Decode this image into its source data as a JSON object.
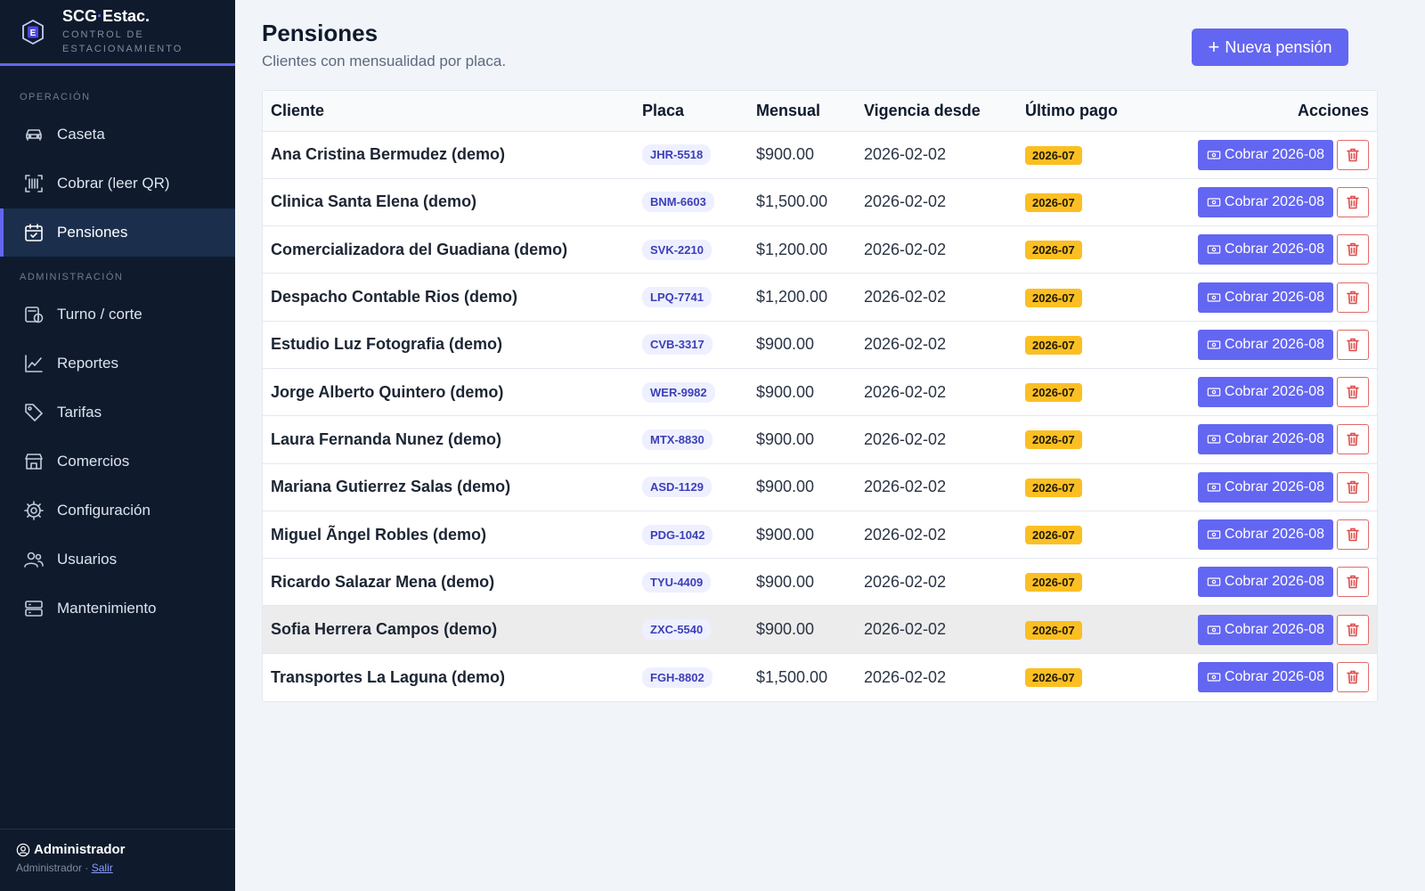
{
  "brand": {
    "name_main": "SCG",
    "name_suffix": "Estac.",
    "subtitle_line1": "CONTROL DE",
    "subtitle_line2": "ESTACIONAMIENTO",
    "logo_letter": "E"
  },
  "sidebar": {
    "section_operacion": "OPERACIÓN",
    "section_admin": "ADMINISTRACIÓN",
    "items": [
      {
        "label": "Caseta",
        "icon": "car-icon"
      },
      {
        "label": "Cobrar (leer QR)",
        "icon": "qr-scan-icon"
      },
      {
        "label": "Pensiones",
        "icon": "calendar-check-icon",
        "active": true
      },
      {
        "label": "Turno / corte",
        "icon": "cash-register-icon"
      },
      {
        "label": "Reportes",
        "icon": "chart-line-icon"
      },
      {
        "label": "Tarifas",
        "icon": "tag-icon"
      },
      {
        "label": "Comercios",
        "icon": "store-icon"
      },
      {
        "label": "Configuración",
        "icon": "gear-icon"
      },
      {
        "label": "Usuarios",
        "icon": "users-icon"
      },
      {
        "label": "Mantenimiento",
        "icon": "server-icon"
      }
    ]
  },
  "footer": {
    "user_name": "Administrador",
    "role": "Administrador",
    "separator": "·",
    "logout_label": "Salir"
  },
  "header": {
    "title": "Pensiones",
    "subtitle": "Clientes con mensualidad por placa.",
    "new_button_label": "Nueva pensión"
  },
  "table": {
    "columns": [
      "Cliente",
      "Placa",
      "Mensual",
      "Vigencia desde",
      "Último pago",
      "Acciones"
    ],
    "charge_label": "Cobrar 2026-08",
    "hover_row": 10,
    "rows": [
      {
        "cliente": "Ana Cristina Bermudez (demo)",
        "placa": "JHR-5518",
        "mensual": "$900.00",
        "vigencia": "2026-02-02",
        "ultimo_pago": "2026-07"
      },
      {
        "cliente": "Clinica Santa Elena (demo)",
        "placa": "BNM-6603",
        "mensual": "$1,500.00",
        "vigencia": "2026-02-02",
        "ultimo_pago": "2026-07"
      },
      {
        "cliente": "Comercializadora del Guadiana (demo)",
        "placa": "SVK-2210",
        "mensual": "$1,200.00",
        "vigencia": "2026-02-02",
        "ultimo_pago": "2026-07"
      },
      {
        "cliente": "Despacho Contable Rios (demo)",
        "placa": "LPQ-7741",
        "mensual": "$1,200.00",
        "vigencia": "2026-02-02",
        "ultimo_pago": "2026-07"
      },
      {
        "cliente": "Estudio Luz Fotografia (demo)",
        "placa": "CVB-3317",
        "mensual": "$900.00",
        "vigencia": "2026-02-02",
        "ultimo_pago": "2026-07"
      },
      {
        "cliente": "Jorge Alberto Quintero (demo)",
        "placa": "WER-9982",
        "mensual": "$900.00",
        "vigencia": "2026-02-02",
        "ultimo_pago": "2026-07"
      },
      {
        "cliente": "Laura Fernanda Nunez (demo)",
        "placa": "MTX-8830",
        "mensual": "$900.00",
        "vigencia": "2026-02-02",
        "ultimo_pago": "2026-07"
      },
      {
        "cliente": "Mariana Gutierrez Salas (demo)",
        "placa": "ASD-1129",
        "mensual": "$900.00",
        "vigencia": "2026-02-02",
        "ultimo_pago": "2026-07"
      },
      {
        "cliente": "Miguel Ãngel Robles (demo)",
        "placa": "PDG-1042",
        "mensual": "$900.00",
        "vigencia": "2026-02-02",
        "ultimo_pago": "2026-07"
      },
      {
        "cliente": "Ricardo Salazar Mena (demo)",
        "placa": "TYU-4409",
        "mensual": "$900.00",
        "vigencia": "2026-02-02",
        "ultimo_pago": "2026-07"
      },
      {
        "cliente": "Sofia Herrera Campos (demo)",
        "placa": "ZXC-5540",
        "mensual": "$900.00",
        "vigencia": "2026-02-02",
        "ultimo_pago": "2026-07"
      },
      {
        "cliente": "Transportes La Laguna (demo)",
        "placa": "FGH-8802",
        "mensual": "$1,500.00",
        "vigencia": "2026-02-02",
        "ultimo_pago": "2026-07"
      }
    ]
  },
  "colors": {
    "accent": "#6366f1",
    "sidebar_bg": "#0f1b2d",
    "badge": "#fbbf24",
    "danger": "#e24b4b"
  }
}
